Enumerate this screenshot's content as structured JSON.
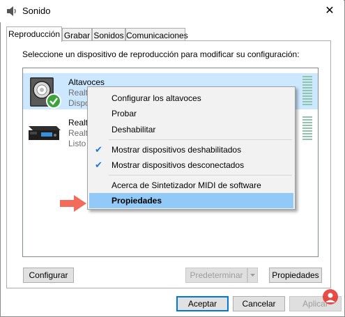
{
  "window": {
    "title": "Sonido",
    "close_glyph": "✕"
  },
  "tabs": [
    {
      "label": "Reproducción",
      "active": true
    },
    {
      "label": "Grabar"
    },
    {
      "label": "Sonidos"
    },
    {
      "label": "Comunicaciones"
    }
  ],
  "instruction": "Seleccione un dispositivo de reproducción para modificar su configuración:",
  "devices": [
    {
      "name": "Altavoces",
      "line2": "Realt",
      "line3": "Dispo",
      "icon": "speaker-icon",
      "default": true
    },
    {
      "name": "Realt",
      "line2": "Realt",
      "line3": "Listo",
      "icon": "receiver-icon"
    }
  ],
  "context_menu": {
    "items": [
      {
        "label": "Configurar los altavoces"
      },
      {
        "label": "Probar"
      },
      {
        "label": "Deshabilitar"
      },
      {
        "label": "Mostrar dispositivos deshabilitados",
        "checked": true
      },
      {
        "label": "Mostrar dispositivos desconectados",
        "checked": true
      },
      {
        "label": "Acerca de Sintetizador MIDI de software"
      },
      {
        "label": "Propiedades",
        "highlighted": true
      }
    ],
    "check_glyph": "✔"
  },
  "buttons": {
    "configure": "Configurar",
    "set_default": "Predeterminar",
    "properties": "Propiedades",
    "ok": "Aceptar",
    "cancel": "Cancelar",
    "apply": "Aplicar"
  },
  "colors": {
    "selection": "#cce8ff",
    "menu_highlight": "#91c9f7",
    "check": "#1976d2",
    "arrow": "#f26b5b",
    "level_meter": "#8fc6ab"
  }
}
